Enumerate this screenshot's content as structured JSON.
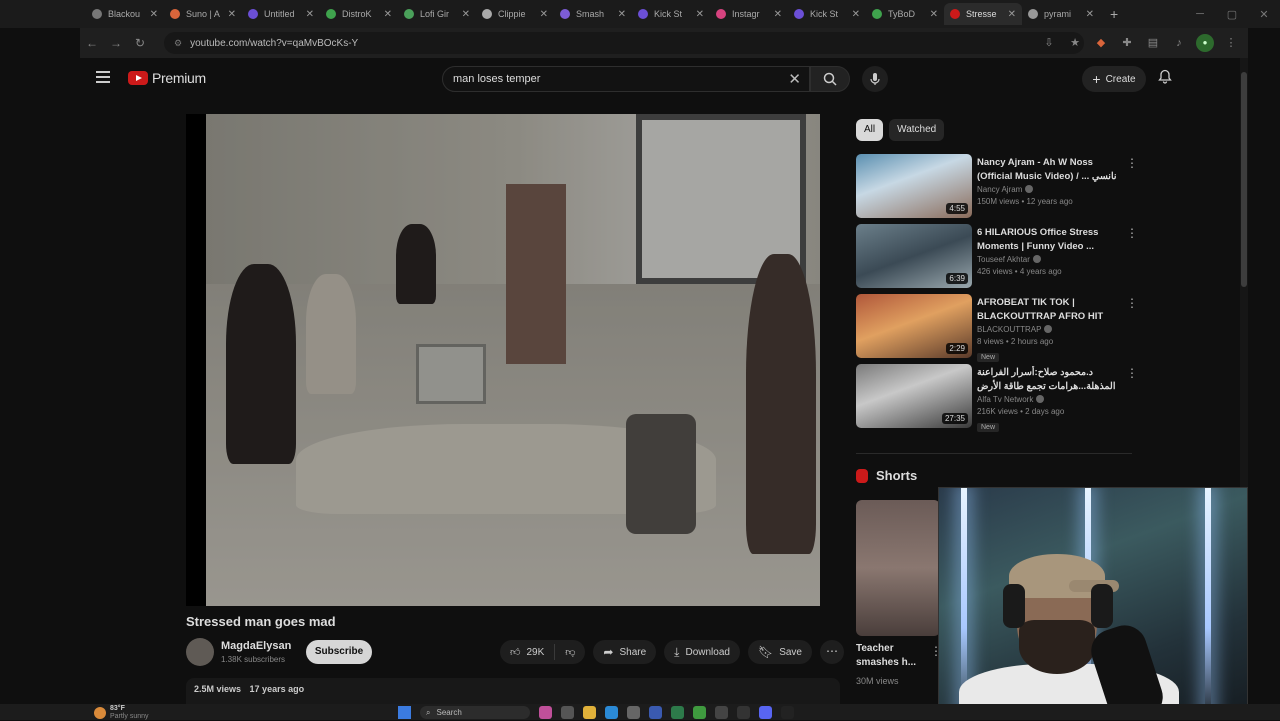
{
  "browser": {
    "tabs": [
      {
        "title": "Blackou",
        "color": "#777777"
      },
      {
        "title": "Suno | A",
        "color": "#d9653b"
      },
      {
        "title": "Untitled",
        "color": "#6b4fd6"
      },
      {
        "title": "DistroK",
        "color": "#3fa34d"
      },
      {
        "title": "Lofi Gir",
        "color": "#4aa05a"
      },
      {
        "title": "Clippie",
        "color": "#aaaaaa"
      },
      {
        "title": "Smash",
        "color": "#7c5cd6"
      },
      {
        "title": "Kick St",
        "color": "#6b4fd6"
      },
      {
        "title": "Instagr",
        "color": "#d6437f"
      },
      {
        "title": "Kick St",
        "color": "#6b4fd6"
      },
      {
        "title": "TyBoD",
        "color": "#3fa34d"
      },
      {
        "title": "Stresse",
        "color": "#cc1a1a",
        "active": true
      },
      {
        "title": "pyrami",
        "color": "#999999"
      }
    ],
    "url": "youtube.com/watch?v=qaMvBOcKs-Y"
  },
  "masthead": {
    "brand": "Premium",
    "search_value": "man loses temper",
    "create_label": "Create"
  },
  "video": {
    "title": "Stressed man goes mad",
    "channel": "MagdaElysan",
    "subscribers": "1.38K subscribers",
    "subscribe_label": "Subscribe",
    "likes": "29K",
    "share_label": "Share",
    "download_label": "Download",
    "save_label": "Save",
    "views": "2.5M views",
    "age": "17 years ago"
  },
  "sidebar": {
    "chips": [
      "All",
      "Watched"
    ],
    "recommendations": [
      {
        "title": "Nancy Ajram - Ah W Noss (Official Music Video) / ... نانسي",
        "channel": "Nancy Ajram",
        "stats": "150M views • 12 years ago",
        "duration": "4:55",
        "badge": ""
      },
      {
        "title": "6 HILARIOUS Office Stress Moments | Funny Video ...",
        "channel": "Touseef Akhtar",
        "stats": "426 views • 4 years ago",
        "duration": "6:39",
        "badge": ""
      },
      {
        "title": "AFROBEAT TIK TOK | BLACKOUTTRAP AFRO HIT",
        "channel": "BLACKOUTTRAP",
        "stats": "8 views • 2 hours ago",
        "duration": "2:29",
        "badge": "New"
      },
      {
        "title": "د.محمود صلاح:أسرار الفراعنة المذهلة...هرامات تجمع طاقة الأرض وتكنولوجيا نقل",
        "channel": "Alfa Tv Network",
        "stats": "216K views • 2 days ago",
        "duration": "27:35",
        "badge": "New"
      }
    ],
    "shorts_title": "Shorts",
    "short": {
      "title": "Teacher smashes h...",
      "views": "30M views"
    }
  },
  "taskbar": {
    "temp": "83°F",
    "condition": "Partly sunny",
    "search": "Search"
  }
}
